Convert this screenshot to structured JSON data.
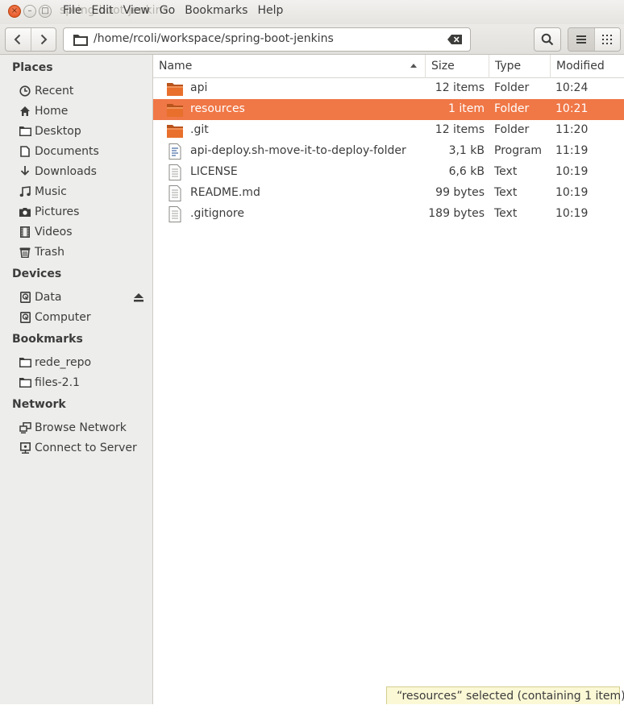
{
  "window": {
    "ghost_title": "spring-boot-jenkins",
    "close_glyph": "×",
    "min_glyph": "–",
    "max_glyph": "□"
  },
  "menubar": [
    "File",
    "Edit",
    "View",
    "Go",
    "Bookmarks",
    "Help"
  ],
  "location": {
    "path": "/home/rcoli/workspace/spring-boot-jenkins"
  },
  "sidebar": {
    "places_header": "Places",
    "places": [
      {
        "label": "Recent",
        "icon": "clock-icon"
      },
      {
        "label": "Home",
        "icon": "home-icon"
      },
      {
        "label": "Desktop",
        "icon": "folder-icon"
      },
      {
        "label": "Documents",
        "icon": "document-icon"
      },
      {
        "label": "Downloads",
        "icon": "download-icon"
      },
      {
        "label": "Music",
        "icon": "music-icon"
      },
      {
        "label": "Pictures",
        "icon": "camera-icon"
      },
      {
        "label": "Videos",
        "icon": "film-icon"
      },
      {
        "label": "Trash",
        "icon": "trash-icon"
      }
    ],
    "devices_header": "Devices",
    "devices": [
      {
        "label": "Data",
        "icon": "drive-icon"
      },
      {
        "label": "Computer",
        "icon": "drive-icon"
      }
    ],
    "bookmarks_header": "Bookmarks",
    "bookmarks": [
      {
        "label": "rede_repo",
        "icon": "folder-icon"
      },
      {
        "label": "files-2.1",
        "icon": "folder-icon"
      }
    ],
    "network_header": "Network",
    "network": [
      {
        "label": "Browse Network",
        "icon": "network-icon"
      },
      {
        "label": "Connect to Server",
        "icon": "server-icon"
      }
    ]
  },
  "columns": {
    "name": "Name",
    "size": "Size",
    "type": "Type",
    "modified": "Modified"
  },
  "files": [
    {
      "name": "api",
      "size": "12 items",
      "type": "Folder",
      "modified": "10:24",
      "kind": "folder",
      "selected": false
    },
    {
      "name": "resources",
      "size": "1 item",
      "type": "Folder",
      "modified": "10:21",
      "kind": "folder",
      "selected": true
    },
    {
      "name": ".git",
      "size": "12 items",
      "type": "Folder",
      "modified": "11:20",
      "kind": "folder",
      "selected": false
    },
    {
      "name": "api-deploy.sh-move-it-to-deploy-folder",
      "size": "3,1 kB",
      "type": "Program",
      "modified": "11:19",
      "kind": "script",
      "selected": false
    },
    {
      "name": "LICENSE",
      "size": "6,6 kB",
      "type": "Text",
      "modified": "10:19",
      "kind": "text",
      "selected": false
    },
    {
      "name": "README.md",
      "size": "99 bytes",
      "type": "Text",
      "modified": "10:19",
      "kind": "text",
      "selected": false
    },
    {
      "name": ".gitignore",
      "size": "189 bytes",
      "type": "Text",
      "modified": "10:19",
      "kind": "text",
      "selected": false
    }
  ],
  "status": {
    "text": "“resources” selected  (containing 1 item)"
  },
  "colors": {
    "accent": "#f07746",
    "folder": "#e8702c",
    "sidebar_bg": "#ededeb"
  }
}
